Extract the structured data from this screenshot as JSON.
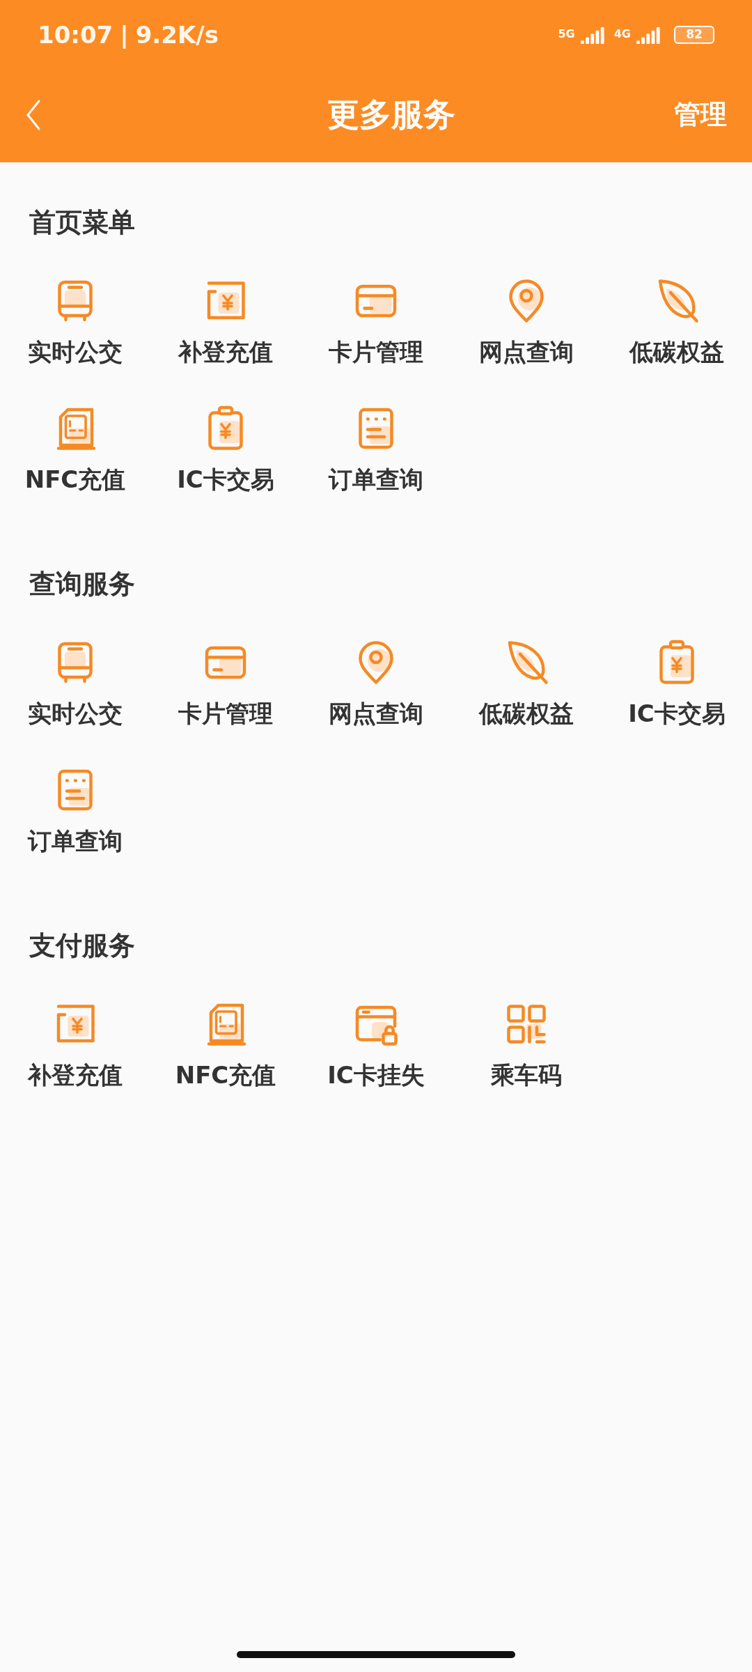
{
  "status_bar": {
    "time": "10:07",
    "separator": "|",
    "speed": "9.2K/s",
    "network_1": "5G",
    "network_2": "4G",
    "battery": "82"
  },
  "header": {
    "title": "更多服务",
    "action": "管理"
  },
  "sections": [
    {
      "title": "首页菜单",
      "items": [
        {
          "label": "实时公交",
          "kind": "bus"
        },
        {
          "label": "补登充值",
          "kind": "recharge"
        },
        {
          "label": "卡片管理",
          "kind": "card"
        },
        {
          "label": "网点查询",
          "kind": "location"
        },
        {
          "label": "低碳权益",
          "kind": "leaf"
        },
        {
          "label": "NFC充值",
          "kind": "nfc"
        },
        {
          "label": "IC卡交易",
          "kind": "clipboard"
        },
        {
          "label": "订单查询",
          "kind": "order"
        }
      ]
    },
    {
      "title": "查询服务",
      "items": [
        {
          "label": "实时公交",
          "kind": "bus"
        },
        {
          "label": "卡片管理",
          "kind": "card"
        },
        {
          "label": "网点查询",
          "kind": "location"
        },
        {
          "label": "低碳权益",
          "kind": "leaf"
        },
        {
          "label": "IC卡交易",
          "kind": "clipboard"
        },
        {
          "label": "订单查询",
          "kind": "order"
        }
      ]
    },
    {
      "title": "支付服务",
      "items": [
        {
          "label": "补登充值",
          "kind": "recharge"
        },
        {
          "label": "NFC充值",
          "kind": "nfc"
        },
        {
          "label": "IC卡挂失",
          "kind": "lock"
        },
        {
          "label": "乘车码",
          "kind": "qr"
        }
      ]
    }
  ]
}
